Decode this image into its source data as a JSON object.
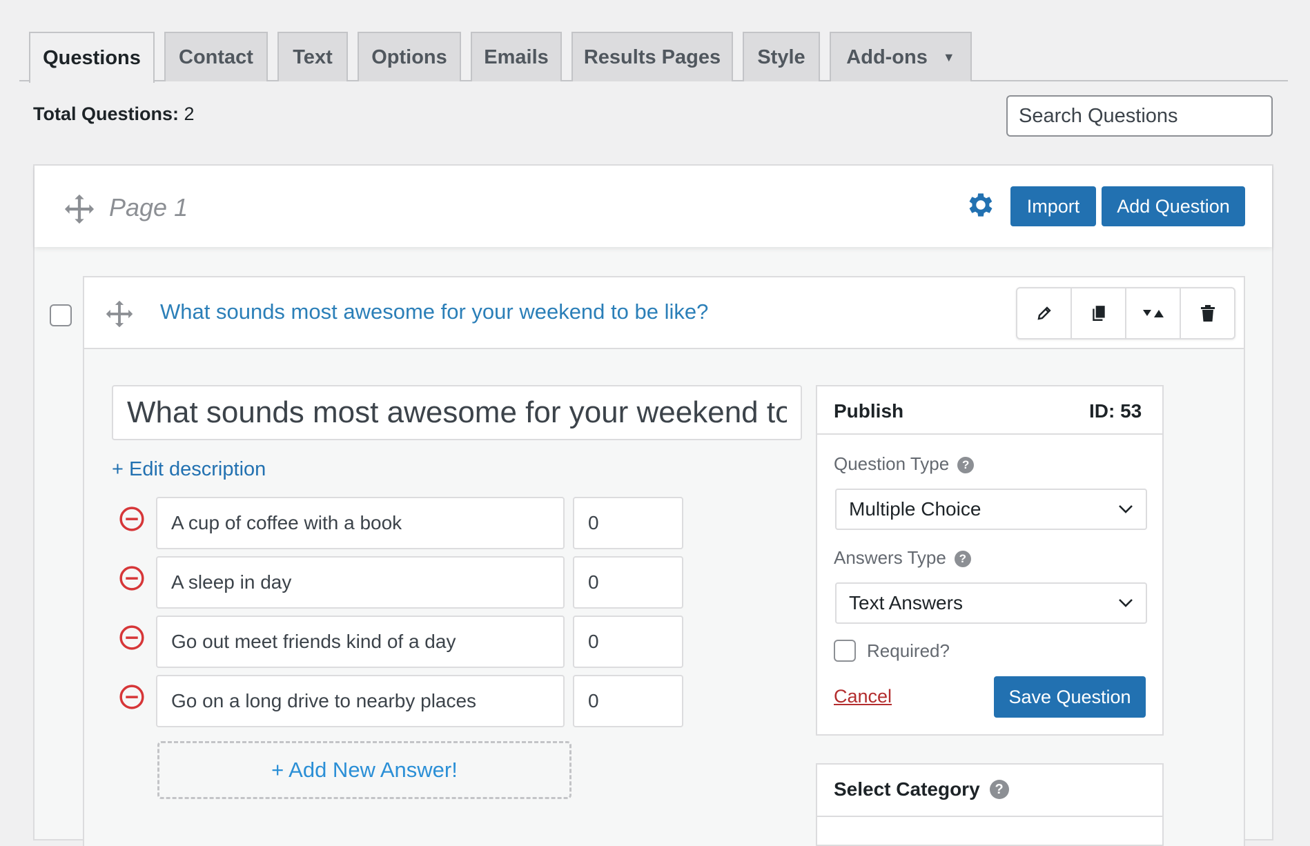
{
  "tabs": [
    {
      "label": "Questions",
      "active": true
    },
    {
      "label": "Contact"
    },
    {
      "label": "Text"
    },
    {
      "label": "Options"
    },
    {
      "label": "Emails"
    },
    {
      "label": "Results Pages"
    },
    {
      "label": "Style"
    },
    {
      "label": "Add-ons"
    }
  ],
  "toolbar": {
    "total_label": "Total Questions:",
    "total_value": "2",
    "search_placeholder": "Search Questions"
  },
  "page": {
    "title": "Page 1",
    "import_label": "Import",
    "add_question_label": "Add Question"
  },
  "question": {
    "title": "What sounds most awesome for your weekend to be like?",
    "edit_value": "What sounds most awesome for your weekend to be like?",
    "edit_description_label": "+ Edit description",
    "answers": [
      {
        "text": "A cup of coffee with a book",
        "points": "0"
      },
      {
        "text": "A sleep in day",
        "points": "0"
      },
      {
        "text": "Go out meet friends kind of a day",
        "points": "0"
      },
      {
        "text": "Go on a long drive to nearby places",
        "points": "0"
      }
    ],
    "add_answer_label": "+ Add New Answer!"
  },
  "publish": {
    "title": "Publish",
    "id_label": "ID: 53",
    "question_type_label": "Question Type",
    "question_type_value": "Multiple Choice",
    "answers_type_label": "Answers Type",
    "answers_type_value": "Text Answers",
    "required_label": "Required?",
    "cancel_label": "Cancel",
    "save_label": "Save Question"
  },
  "category": {
    "title": "Select Category"
  },
  "colors": {
    "primary": "#2271b1",
    "link": "#2b7fb8",
    "danger": "#d63638",
    "background": "#f0f0f1"
  }
}
